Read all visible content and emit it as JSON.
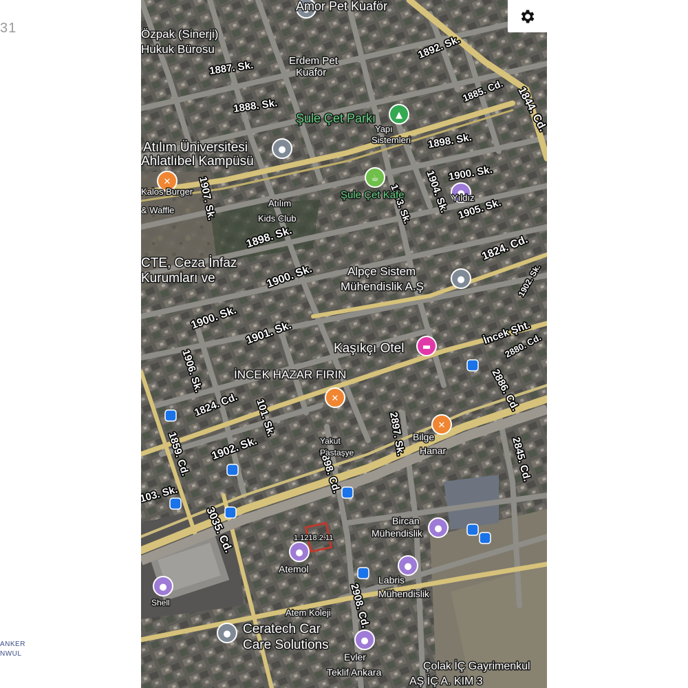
{
  "page": {
    "number": "31",
    "logo_line1": "ANKER",
    "logo_line2": "NWUL"
  },
  "settings": {
    "icon": "gear-icon"
  },
  "colors": {
    "main_road": "#d8c47a",
    "street": "#8e8c86",
    "hotel_pin": "#e239a9",
    "food_pin": "#f08632",
    "place_pin": "#9e7bd6",
    "generic_pin": "#7f8a96",
    "park_pin": "#35a853",
    "transit": "#1a73e8",
    "parcel": "#c0392b"
  },
  "map": {
    "streets": [
      {
        "id": "s1844",
        "text": "1844. Cd."
      },
      {
        "id": "s1892",
        "text": "1892. Sk."
      },
      {
        "id": "s1887",
        "text": "1887. Sk."
      },
      {
        "id": "s1888",
        "text": "1888. Sk."
      },
      {
        "id": "s1885",
        "text": "1885. Cd."
      },
      {
        "id": "s1898a",
        "text": "1898. Sk."
      },
      {
        "id": "s1900a",
        "text": "1900. Sk."
      },
      {
        "id": "s1905",
        "text": "1905. Sk."
      },
      {
        "id": "s1904",
        "text": "1904. Sk."
      },
      {
        "id": "s1903",
        "text": "1903. Sk."
      },
      {
        "id": "s1907",
        "text": "1907. Sk."
      },
      {
        "id": "s1898b",
        "text": "1898. Sk."
      },
      {
        "id": "s1824a",
        "text": "1824. Cd."
      },
      {
        "id": "s1900b",
        "text": "1900. Sk."
      },
      {
        "id": "s1900c",
        "text": "1900. Sk."
      },
      {
        "id": "s1901",
        "text": "1901. Sk."
      },
      {
        "id": "s1902a",
        "text": "1902. Sk."
      },
      {
        "id": "sincek",
        "text": "İncek Şht."
      },
      {
        "id": "s2880",
        "text": "2880. Cd."
      },
      {
        "id": "s2886",
        "text": "2886. Cd."
      },
      {
        "id": "s1906",
        "text": "1906. Sk."
      },
      {
        "id": "s1824b",
        "text": "1824. Cd."
      },
      {
        "id": "s101",
        "text": "101. Sk."
      },
      {
        "id": "s1902b",
        "text": "1902. Sk."
      },
      {
        "id": "s1859",
        "text": "1859. Cd."
      },
      {
        "id": "s2897",
        "text": "2897. Sk."
      },
      {
        "id": "s2898",
        "text": "2898. Cd."
      },
      {
        "id": "s2845",
        "text": "2845. Cd."
      },
      {
        "id": "s103",
        "text": "103. Sk."
      },
      {
        "id": "s3035",
        "text": "3035. Cd."
      },
      {
        "id": "s2908",
        "text": "2908. Cd."
      }
    ],
    "pois": [
      {
        "id": "amor",
        "text": "Amor Pet Kuaför",
        "pin": "generic"
      },
      {
        "id": "ozp1",
        "text": "Özpak (Sinerji)",
        "pin": "none"
      },
      {
        "id": "ozp2",
        "text": "Hukuk Bürosu",
        "pin": "none"
      },
      {
        "id": "erd1",
        "text": "Erdem Pet",
        "pin": "none"
      },
      {
        "id": "erd2",
        "text": "Kuaför",
        "pin": "none"
      },
      {
        "id": "sule",
        "text": "Şule Çet Parkı",
        "pin": "park"
      },
      {
        "id": "yapi1",
        "text": "Yapı",
        "pin": "none"
      },
      {
        "id": "yapi2",
        "text": "Sistemleri",
        "pin": "none"
      },
      {
        "id": "atilim1",
        "text": "Atılım Üniversitesi",
        "pin": "generic"
      },
      {
        "id": "atilim2",
        "text": "Ahlatlıbel Kampüsü",
        "pin": "none"
      },
      {
        "id": "kafe",
        "text": "Şule Çet Kafe",
        "pin": "cafe"
      },
      {
        "id": "burger1",
        "text": "Kalos Burger",
        "pin": "food"
      },
      {
        "id": "burger2",
        "text": "& Waffle",
        "pin": "none"
      },
      {
        "id": "kids1",
        "text": "Atılım",
        "pin": "none"
      },
      {
        "id": "kids2",
        "text": "Kids Club",
        "pin": "none"
      },
      {
        "id": "yildiz",
        "text": "Yıldız",
        "pin": "place"
      },
      {
        "id": "cte1",
        "text": "CTE, Ceza İnfaz",
        "pin": "none"
      },
      {
        "id": "cte2",
        "text": "Kurumları ve",
        "pin": "none"
      },
      {
        "id": "alpce1",
        "text": "Alpçe Sistem",
        "pin": "generic"
      },
      {
        "id": "alpce2",
        "text": "Mühendislik A.Ş",
        "pin": "none"
      },
      {
        "id": "kasikci",
        "text": "Kaşıkçı Otel",
        "pin": "hotel"
      },
      {
        "id": "hazar",
        "text": "İNCEK HAZAR FIRIN",
        "pin": "food"
      },
      {
        "id": "yakut1",
        "text": "Yakut",
        "pin": "none"
      },
      {
        "id": "yakut2",
        "text": "Pastaşye",
        "pin": "none"
      },
      {
        "id": "bilge1",
        "text": "Bilge",
        "pin": "food"
      },
      {
        "id": "bilge2",
        "text": "Hanar",
        "pin": "none"
      },
      {
        "id": "bircan1",
        "text": "Bircan",
        "pin": "place"
      },
      {
        "id": "bircan2",
        "text": "Mühendislik",
        "pin": "none"
      },
      {
        "id": "parcel",
        "text": "1.1218.2.11",
        "pin": "none"
      },
      {
        "id": "atem",
        "text": "Atemol",
        "pin": "place"
      },
      {
        "id": "labris1",
        "text": "Labris",
        "pin": "place"
      },
      {
        "id": "labris2",
        "text": "Mühendislik",
        "pin": "none"
      },
      {
        "id": "kolej",
        "text": "Atem Koleji",
        "pin": "none"
      },
      {
        "id": "cera1",
        "text": "Ceratech Car",
        "pin": "generic"
      },
      {
        "id": "cera2",
        "text": "Care Solutions",
        "pin": "none"
      },
      {
        "id": "teklif1",
        "text": "Evler",
        "pin": "place"
      },
      {
        "id": "teklif2",
        "text": "Teklif Ankara",
        "pin": "none"
      },
      {
        "id": "colak1",
        "text": "Çolak İÇ Gayrimenkul",
        "pin": "none"
      },
      {
        "id": "colak2",
        "text": "AŞ İÇ A. KIM 3",
        "pin": "none"
      },
      {
        "id": "shell",
        "text": "Shell",
        "pin": "place"
      }
    ]
  }
}
